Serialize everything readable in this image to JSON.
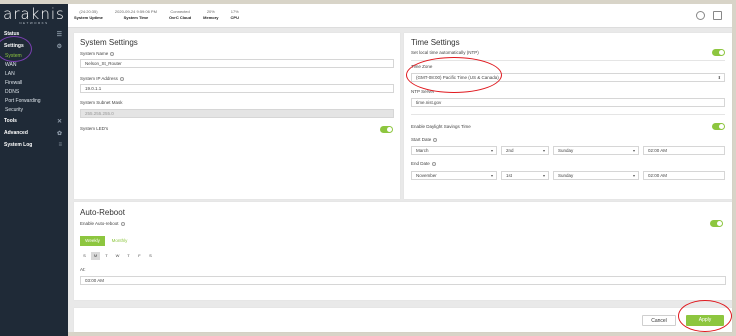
{
  "brand": {
    "name": "araknis",
    "sub": "NETWORKS"
  },
  "stats": [
    {
      "value": "(24:20:35)",
      "label": "System Uptime"
    },
    {
      "value": "2020-09-24 9:59:06 PM",
      "label": "System Time"
    },
    {
      "value": "Connected",
      "label": "OvrC Cloud"
    },
    {
      "value": "20%",
      "label": "Memory"
    },
    {
      "value": "17%",
      "label": "CPU"
    }
  ],
  "sidebar": {
    "status": "Status",
    "settings": "Settings",
    "items": [
      "System",
      "WAN",
      "LAN",
      "Firewall",
      "DDNS",
      "Port Forwarding",
      "Security"
    ],
    "tools": "Tools",
    "advanced": "Advanced",
    "system_log": "System Log"
  },
  "system_settings": {
    "title": "System Settings",
    "name_label": "System Name",
    "name_value": "Nelson_St_Router",
    "ip_label": "System IP Address",
    "ip_value": "19.0.1.1",
    "mask_label": "System Subnet Mask",
    "mask_value": "255.255.255.0",
    "leds_label": "System LED's"
  },
  "time_settings": {
    "title": "Time Settings",
    "ntp_label": "Set local time automatically (NTP)",
    "tz_label": "Time Zone",
    "tz_value": "(GMT-08:00) Pacific Time (US & Canada)",
    "ntp_server_label": "NTP Server",
    "ntp_server_value": "time.nist.gov",
    "dst_label": "Enable Daylight Savings Time",
    "start_label": "Start Date",
    "start": [
      "March",
      "2nd",
      "Sunday",
      "02:00 AM"
    ],
    "end_label": "End Date",
    "end": [
      "November",
      "1st",
      "Sunday",
      "02:00 AM"
    ]
  },
  "auto_reboot": {
    "title": "Auto-Reboot",
    "enable_label": "Enable Auto-reboot",
    "weekly": "Weekly",
    "monthly": "Monthly",
    "days": [
      "S",
      "M",
      "T",
      "W",
      "T",
      "F",
      "S"
    ],
    "at_label": "At:",
    "at_value": "03:00 AM"
  },
  "actions": {
    "cancel": "Cancel",
    "apply": "Apply"
  },
  "colors": {
    "accent": "#8dc63f",
    "sidebar": "#1f2a37",
    "annotation": "#e0191f"
  }
}
